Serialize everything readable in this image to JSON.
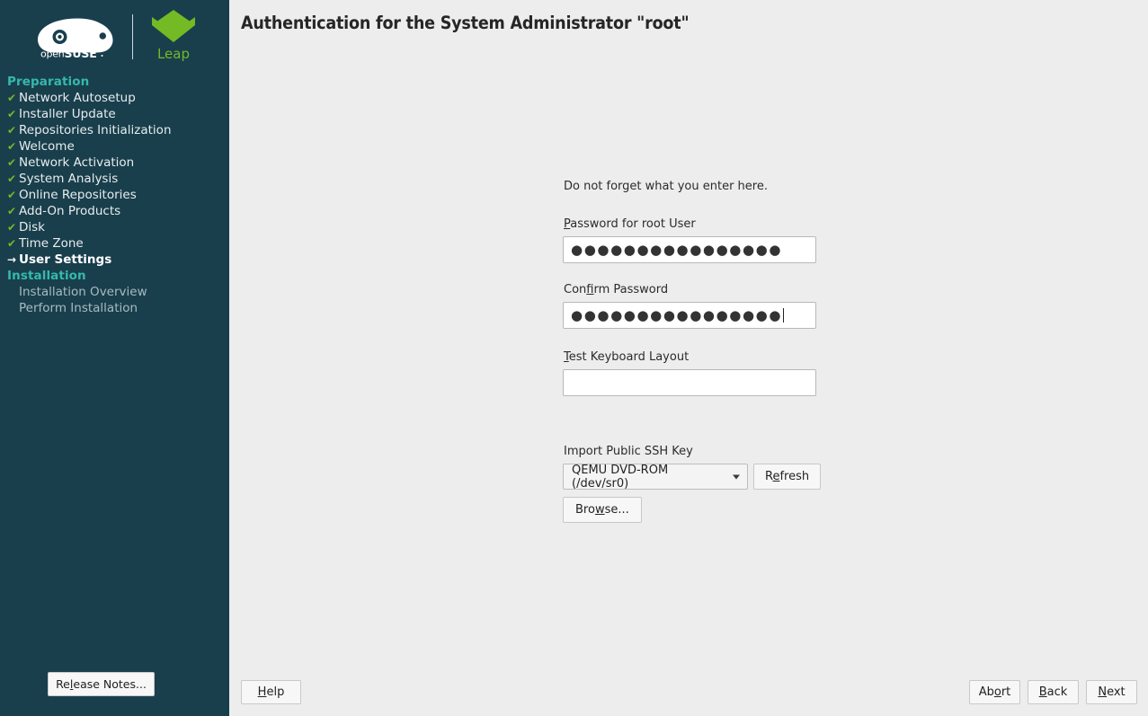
{
  "sidebar": {
    "logo": {
      "suse_name": "openSUSE",
      "product_name": "Leap",
      "leap_color": "#73BA25"
    },
    "section_color": "#35B9AB",
    "check_color": "#73BA25",
    "background": "#193F4D",
    "groups": [
      {
        "title": "Preparation",
        "items": [
          {
            "label": "Network Autosetup",
            "state": "done",
            "mark": "✔"
          },
          {
            "label": "Installer Update",
            "state": "done",
            "mark": "✔"
          },
          {
            "label": "Repositories Initialization",
            "state": "done",
            "mark": "✔"
          },
          {
            "label": "Welcome",
            "state": "done",
            "mark": "✔"
          },
          {
            "label": "Network Activation",
            "state": "done",
            "mark": "✔"
          },
          {
            "label": "System Analysis",
            "state": "done",
            "mark": "✔"
          },
          {
            "label": "Online Repositories",
            "state": "done",
            "mark": "✔"
          },
          {
            "label": "Add-On Products",
            "state": "done",
            "mark": "✔"
          },
          {
            "label": "Disk",
            "state": "done",
            "mark": "✔"
          },
          {
            "label": "Time Zone",
            "state": "done",
            "mark": "✔"
          },
          {
            "label": "User Settings",
            "state": "current",
            "mark": "→"
          }
        ]
      },
      {
        "title": "Installation",
        "items": [
          {
            "label": "Installation Overview",
            "state": "future",
            "mark": ""
          },
          {
            "label": "Perform Installation",
            "state": "future",
            "mark": ""
          }
        ]
      }
    ],
    "release_notes_button": {
      "prefix": "Re",
      "mnemonic": "l",
      "suffix": "ease Notes..."
    }
  },
  "header": {
    "title": "Authentication for the System Administrator \"root\"",
    "dark_mode_icon": "moon-icon"
  },
  "form": {
    "hint": "Do not forget what you enter here.",
    "root_password": {
      "label_prefix": "",
      "label_mnemonic": "P",
      "label_suffix": "assword for root User",
      "value_masked": "●●●●●●●●●●●●●●●●",
      "char_count": 16,
      "focused": false
    },
    "confirm_password": {
      "label_prefix": "Con",
      "label_mnemonic": "f",
      "label_suffix": "irm Password",
      "value_masked": "●●●●●●●●●●●●●●●●",
      "char_count": 16,
      "focused": true
    },
    "test_keyboard": {
      "label_prefix": "",
      "label_mnemonic": "T",
      "label_suffix": "est Keyboard Layout",
      "value": "",
      "placeholder": ""
    },
    "ssh_key": {
      "label": "Import Public SSH Key",
      "selected_device": "QEMU DVD-ROM (/dev/sr0)",
      "options": [
        "QEMU DVD-ROM (/dev/sr0)"
      ],
      "refresh_button": {
        "prefix": "R",
        "mnemonic": "e",
        "suffix": "fresh"
      },
      "browse_button": {
        "prefix": "Bro",
        "mnemonic": "w",
        "suffix": "se..."
      }
    }
  },
  "footer": {
    "help": {
      "prefix": "",
      "mnemonic": "H",
      "suffix": "elp"
    },
    "abort": {
      "prefix": "Ab",
      "mnemonic": "o",
      "suffix": "rt"
    },
    "back": {
      "prefix": "",
      "mnemonic": "B",
      "suffix": "ack"
    },
    "next": {
      "prefix": "",
      "mnemonic": "N",
      "suffix": "ext"
    }
  }
}
